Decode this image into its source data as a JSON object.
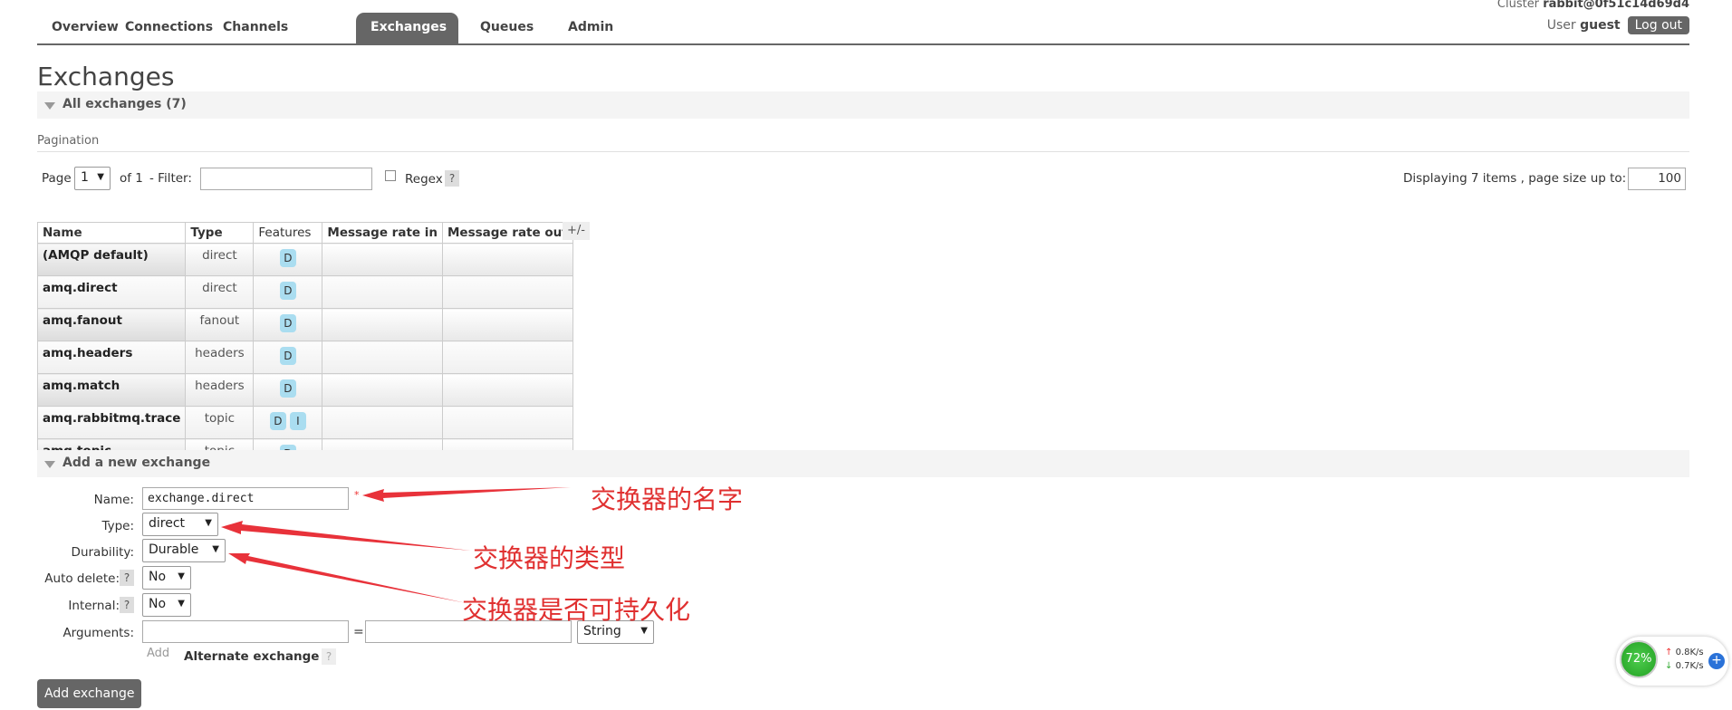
{
  "nav": {
    "tabs": [
      "Overview",
      "Connections",
      "Channels",
      "Exchanges",
      "Queues",
      "Admin"
    ],
    "active": "Exchanges"
  },
  "header": {
    "cluster_label": "Cluster",
    "cluster_name": "rabbit@0f51c14d69d4",
    "user_label": "User",
    "user_name": "guest",
    "logout": "Log out"
  },
  "page": {
    "title": "Exchanges",
    "all_section": "All exchanges (7)"
  },
  "pagination": {
    "heading": "Pagination",
    "page_label": "Page",
    "page_value": "1",
    "of_label": "of 1",
    "filter_label": "- Filter:",
    "regex_label": "Regex",
    "help": "?",
    "display_text": "Displaying 7 items , page size up to:",
    "page_size": "100"
  },
  "table": {
    "headers": {
      "name": "Name",
      "type": "Type",
      "features": "Features",
      "rate_in": "Message rate in",
      "rate_out": "Message rate out"
    },
    "toggle": "+/-",
    "rows": [
      {
        "name": "(AMQP default)",
        "type": "direct",
        "features": [
          "D"
        ]
      },
      {
        "name": "amq.direct",
        "type": "direct",
        "features": [
          "D"
        ]
      },
      {
        "name": "amq.fanout",
        "type": "fanout",
        "features": [
          "D"
        ]
      },
      {
        "name": "amq.headers",
        "type": "headers",
        "features": [
          "D"
        ]
      },
      {
        "name": "amq.match",
        "type": "headers",
        "features": [
          "D"
        ]
      },
      {
        "name": "amq.rabbitmq.trace",
        "type": "topic",
        "features": [
          "D",
          "I"
        ]
      },
      {
        "name": "amq.topic",
        "type": "topic",
        "features": [
          "D"
        ]
      }
    ]
  },
  "add_form": {
    "section": "Add a new exchange",
    "name_label": "Name:",
    "name_value": "exchange.direct",
    "required_mark": "*",
    "type_label": "Type:",
    "type_value": "direct",
    "durability_label": "Durability:",
    "durability_value": "Durable",
    "auto_delete_label": "Auto delete:",
    "auto_delete_value": "No",
    "internal_label": "Internal:",
    "internal_value": "No",
    "arguments_label": "Arguments:",
    "equals": "=",
    "arg_type_value": "String",
    "add_link": "Add",
    "alternate_exchange": "Alternate exchange",
    "help": "?",
    "submit": "Add exchange"
  },
  "annotations": {
    "name": "交换器的名字",
    "type": "交换器的类型",
    "durability": "交换器是否可持久化",
    "color": "#e03030"
  },
  "widget": {
    "percent": "72%",
    "up_rate": "0.8K/s",
    "down_rate": "0.7K/s"
  }
}
